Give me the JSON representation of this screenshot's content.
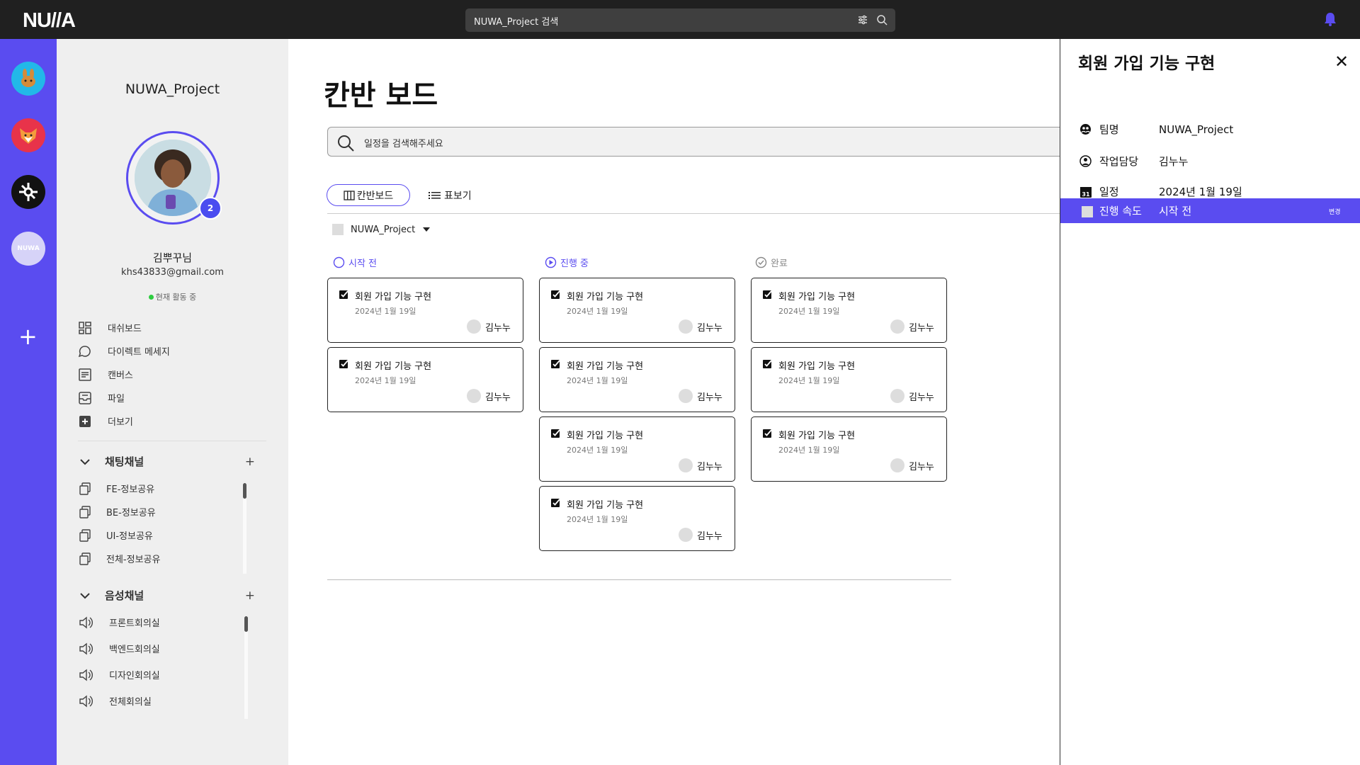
{
  "topbar": {
    "logo": "NU//A",
    "search_value": "NUWA_Project 검색"
  },
  "colors": {
    "brand": "#5a4cf0",
    "topbar": "#202020",
    "online": "#2ecc40"
  },
  "workspaces": [
    {
      "name": "bunny-workspace",
      "label": ""
    },
    {
      "name": "fox-workspace",
      "label": ""
    },
    {
      "name": "dark-workspace",
      "label": ""
    },
    {
      "name": "nuwa-workspace",
      "label": "NUWA"
    }
  ],
  "sidebar": {
    "project_name": "NUWA_Project",
    "notification_count": "2",
    "user_name": "김뿌꾸님",
    "user_email": "khs43833@gmail.com",
    "user_status": "현재 활동 중",
    "nav": [
      {
        "label": "대쉬보드",
        "icon": "dashboard-icon"
      },
      {
        "label": "다이렉트 메세지",
        "icon": "chat-bubble-icon"
      },
      {
        "label": "캔버스",
        "icon": "canvas-icon"
      },
      {
        "label": "파일",
        "icon": "inbox-icon"
      },
      {
        "label": "더보기",
        "icon": "plus-square-icon"
      }
    ],
    "chat_section": {
      "title": "채팅채널",
      "channels": [
        "FE-정보공유",
        "BE-정보공유",
        "UI-정보공유",
        "전체-정보공유"
      ]
    },
    "voice_section": {
      "title": "음성채널",
      "channels": [
        "프론트회의실",
        "백엔드회의실",
        "디자인회의실",
        "전체회의실"
      ]
    }
  },
  "main": {
    "title": "칸반 보드",
    "search_placeholder": "일정을 검색해주세요",
    "tabs": {
      "kanban": "칸반보드",
      "table": "표보기"
    },
    "project_filter": "NUWA_Project",
    "columns": [
      {
        "status": "시작 전",
        "cards": [
          {
            "title": "회원 가입 기능 구현",
            "date": "2024년 1월 19일",
            "assignee": "김누누"
          },
          {
            "title": "회원 가입 기능 구현",
            "date": "2024년 1월 19일",
            "assignee": "김누누"
          }
        ]
      },
      {
        "status": "진행 중",
        "cards": [
          {
            "title": "회원 가입 기능 구현",
            "date": "2024년 1월 19일",
            "assignee": "김누누"
          },
          {
            "title": "회원 가입 기능 구현",
            "date": "2024년 1월 19일",
            "assignee": "김누누"
          },
          {
            "title": "회원 가입 기능 구현",
            "date": "2024년 1월 19일",
            "assignee": "김누누"
          },
          {
            "title": "회원 가입 기능 구현",
            "date": "2024년 1월 19일",
            "assignee": "김누누"
          }
        ]
      },
      {
        "status": "완료",
        "cards": [
          {
            "title": "회원 가입 기능 구현",
            "date": "2024년 1월 19일",
            "assignee": "김누누"
          },
          {
            "title": "회원 가입 기능 구현",
            "date": "2024년 1월 19일",
            "assignee": "김누누"
          },
          {
            "title": "회원 가입 기능 구현",
            "date": "2024년 1월 19일",
            "assignee": "김누누"
          }
        ]
      }
    ]
  },
  "panel": {
    "title": "회원 가입 기능 구현",
    "rows": [
      {
        "label": "팀명",
        "value": "NUWA_Project",
        "icon": "team-icon"
      },
      {
        "label": "작업담당",
        "value": "김누누",
        "icon": "user-icon"
      },
      {
        "label": "일정",
        "value": "2024년 1월 19일",
        "icon": "calendar-icon",
        "icon_text": "31"
      },
      {
        "label": "진행 속도",
        "value": "시작 전",
        "icon": "status-square-icon",
        "action": "변경"
      }
    ]
  }
}
